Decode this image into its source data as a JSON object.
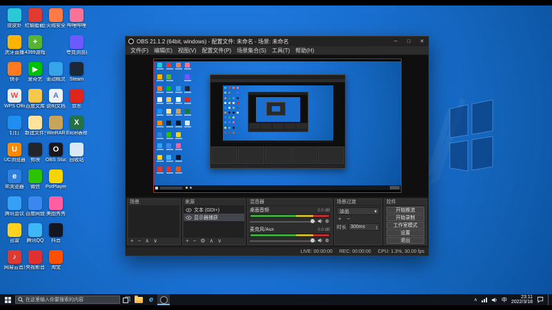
{
  "taskbar": {
    "search_placeholder": "在这里输入你要搜索的内容",
    "ie_glyph": "e",
    "tray": {
      "chevron": "∧",
      "ime": "中",
      "time": "23:11",
      "date": "2022/3/18"
    }
  },
  "desktop": {
    "icons": [
      {
        "label": "皮皮虾",
        "color": "#2bc8d8",
        "col": 0,
        "row": 0
      },
      {
        "label": "虎牙直播",
        "color": "#ffb400",
        "col": 0,
        "row": 1
      },
      {
        "label": "快手",
        "color": "#ff7a1e",
        "col": 0,
        "row": 2
      },
      {
        "label": "WPS Office",
        "color": "#eceef0",
        "fg": "#e84c3d",
        "glyph": "W",
        "col": 0,
        "row": 3
      },
      {
        "label": "钉钉",
        "color": "#1e8ff0",
        "col": 0,
        "row": 4
      },
      {
        "label": "UC浏览器",
        "color": "#ff8a00",
        "glyph": "U",
        "col": 0,
        "row": 5
      },
      {
        "label": "IE浏览器",
        "color": "#2d7fe0",
        "glyph": "e",
        "col": 0,
        "row": 6
      },
      {
        "label": "腾讯会议",
        "color": "#35a0f5",
        "col": 0,
        "row": 7
      },
      {
        "label": "迅雷",
        "color": "#ffd21e",
        "col": 0,
        "row": 8
      },
      {
        "label": "网易云音乐",
        "color": "#dd3a32",
        "glyph": "♪",
        "col": 0,
        "row": 9
      },
      {
        "label": "红蜻蜓截图",
        "color": "#e23a2e",
        "col": 1,
        "row": 0
      },
      {
        "label": "4399游戏盒",
        "color": "#55b531",
        "glyph": "+",
        "col": 1,
        "row": 1
      },
      {
        "label": "爱奇艺",
        "color": "#00c006",
        "glyph": "▶",
        "col": 1,
        "row": 2
      },
      {
        "label": "百度文库",
        "color": "#f7c84a",
        "col": 1,
        "row": 3
      },
      {
        "label": "新建文件夹",
        "color": "#ffe39a",
        "col": 1,
        "row": 4
      },
      {
        "label": "剪映",
        "color": "#23252c",
        "col": 1,
        "row": 5
      },
      {
        "label": "微信",
        "color": "#2dc100",
        "col": 1,
        "row": 6
      },
      {
        "label": "百度网盘",
        "color": "#3a87f0",
        "col": 1,
        "row": 7
      },
      {
        "label": "腾讯QQ",
        "color": "#3fb6f5",
        "col": 1,
        "row": 8
      },
      {
        "label": "央视影音",
        "color": "#e03030",
        "col": 1,
        "row": 9
      },
      {
        "label": "火绒安全",
        "color": "#ff7a45",
        "col": 2,
        "row": 0
      },
      {
        "label": "驱动精灵",
        "color": "#35a4e8",
        "col": 2,
        "row": 2
      },
      {
        "label": "说明文档",
        "color": "#eef2f6",
        "fg": "#4a78c8",
        "glyph": "A",
        "col": 2,
        "row": 3
      },
      {
        "label": "WinRAR",
        "color": "#c8a35a",
        "col": 2,
        "row": 4
      },
      {
        "label": "OBS Studio",
        "color": "#17171d",
        "glyph": "O",
        "col": 2,
        "row": 5
      },
      {
        "label": "PotPlayer",
        "color": "#f5d400",
        "col": 2,
        "row": 6
      },
      {
        "label": "美图秀秀",
        "color": "#ff5fa2",
        "col": 2,
        "row": 7
      },
      {
        "label": "抖音",
        "color": "#14161f",
        "col": 2,
        "row": 8
      },
      {
        "label": "淘宝",
        "color": "#ff5000",
        "col": 2,
        "row": 9
      },
      {
        "label": "哔哩哔哩",
        "color": "#fb7299",
        "col": 3,
        "row": 0
      },
      {
        "label": "夸克浏览器",
        "color": "#6a5aff",
        "col": 3,
        "row": 1
      },
      {
        "label": "Steam",
        "color": "#1b2838",
        "col": 3,
        "row": 2
      },
      {
        "label": "京东",
        "color": "#e1251b",
        "col": 3,
        "row": 3
      },
      {
        "label": "Excel表格",
        "color": "#217346",
        "glyph": "X",
        "col": 3,
        "row": 4
      },
      {
        "label": "回收站",
        "color": "#d8e8f5",
        "col": 3,
        "row": 5
      }
    ]
  },
  "obs": {
    "title": "OBS 21.1.2 (64bit, windows) - 配置文件: 未命名 - 场景: 未命名",
    "menus": [
      {
        "id": "file",
        "label": "文件(F)"
      },
      {
        "id": "edit",
        "label": "编辑(E)"
      },
      {
        "id": "view",
        "label": "视图(V)"
      },
      {
        "id": "profile",
        "label": "配置文件(P)"
      },
      {
        "id": "scene-collection",
        "label": "场景集合(S)"
      },
      {
        "id": "tools",
        "label": "工具(T)"
      },
      {
        "id": "help",
        "label": "帮助(H)"
      }
    ],
    "window_buttons": [
      {
        "name": "minimize-button",
        "glyph": "─"
      },
      {
        "name": "maximize-button",
        "glyph": "□"
      },
      {
        "name": "close-button",
        "glyph": "✕"
      }
    ],
    "docks": {
      "scenes": {
        "title": "场景",
        "toolbar": [
          {
            "name": "add-scene-button",
            "glyph": "+"
          },
          {
            "name": "remove-scene-button",
            "glyph": "−"
          },
          {
            "name": "scene-up-button",
            "glyph": "∧"
          },
          {
            "name": "scene-down-button",
            "glyph": "∨"
          }
        ]
      },
      "sources": {
        "title": "来源",
        "items": [
          {
            "label": "文本 (GDI+)",
            "selected": false
          },
          {
            "label": "显示器捕获",
            "selected": true
          }
        ],
        "toolbar": [
          {
            "name": "add-source-button",
            "glyph": "+"
          },
          {
            "name": "remove-source-button",
            "glyph": "−"
          },
          {
            "name": "source-properties-button",
            "glyph": "⚙"
          },
          {
            "name": "source-up-button",
            "glyph": "∧"
          },
          {
            "name": "source-down-button",
            "glyph": "∨"
          }
        ]
      },
      "mixer": {
        "title": "混音器",
        "channels": [
          {
            "name": "桌面音频",
            "db": "0.0 dB",
            "slider": 95
          },
          {
            "name": "麦克风/Aux",
            "db": "0.0 dB",
            "slider": 95
          }
        ]
      },
      "transitions": {
        "title": "场景过渡",
        "selected": "淡出",
        "caret": "▾",
        "buttons": [
          {
            "name": "add-transition-button",
            "glyph": "+"
          },
          {
            "name": "remove-transition-button",
            "glyph": "−"
          }
        ],
        "duration_label": "时长",
        "duration_value": "300ms",
        "spin_up": "▴",
        "spin_down": "▾"
      },
      "controls": {
        "title": "控件",
        "buttons": [
          {
            "name": "start-streaming-button",
            "label": "开始推流"
          },
          {
            "name": "start-recording-button",
            "label": "开始录制"
          },
          {
            "name": "studio-mode-button",
            "label": "工作室模式"
          },
          {
            "name": "settings-button",
            "label": "设置"
          },
          {
            "name": "exit-button",
            "label": "退出"
          }
        ]
      }
    },
    "status": {
      "live": "LIVE: 00:00:00",
      "rec": "REC: 00:00:00",
      "cpu": "CPU: 1.3%, 30.00 fps"
    }
  }
}
